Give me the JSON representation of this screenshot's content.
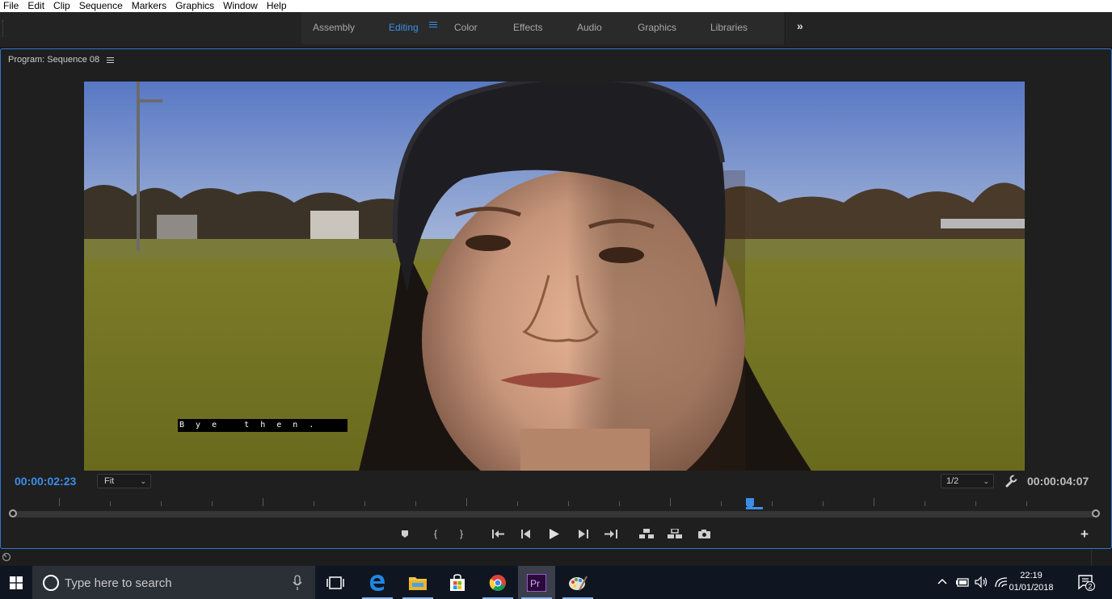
{
  "menubar": {
    "items": [
      "File",
      "Edit",
      "Clip",
      "Sequence",
      "Markers",
      "Graphics",
      "Window",
      "Help"
    ]
  },
  "workspaces": {
    "tabs": [
      "Assembly",
      "Editing",
      "Color",
      "Effects",
      "Audio",
      "Graphics",
      "Libraries"
    ],
    "active": "Editing"
  },
  "program": {
    "title": "Program: Sequence 08",
    "caption": "B y e   t h e n .",
    "timecode_current": "00:00:02:23",
    "timecode_duration": "00:00:04:07",
    "zoom": "Fit",
    "resolution": "1/2",
    "playhead_position": 0.68
  },
  "taskbar": {
    "search_placeholder": "Type here to search",
    "time": "22:19",
    "date": "01/01/2018",
    "notification_count": "2"
  },
  "colors": {
    "accent": "#3b8ee8",
    "panel_border": "#2d77d2",
    "taskbar": "#101621"
  }
}
